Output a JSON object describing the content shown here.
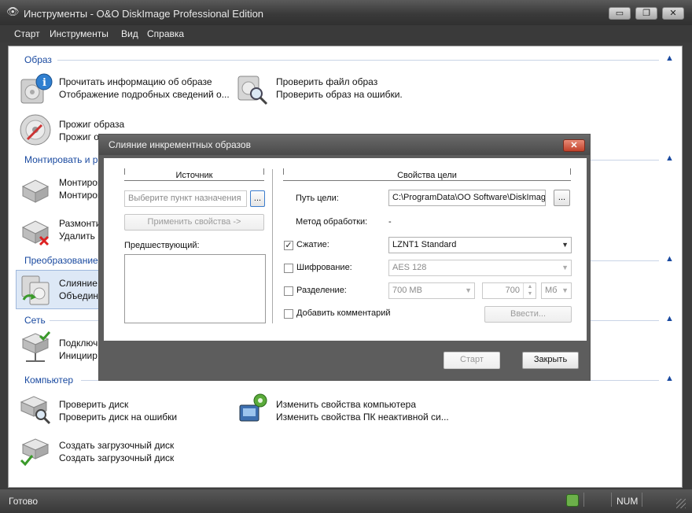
{
  "window": {
    "title": "Инструменты - O&O DiskImage Professional Edition",
    "controls": {
      "minimize": "▭",
      "restore": "❐",
      "close": "✕"
    }
  },
  "menu": [
    "Старт",
    "Инструменты",
    "Вид",
    "Справка"
  ],
  "sections": {
    "image": {
      "title": "Образ",
      "tasks": [
        {
          "title": "Прочитать информацию об образе",
          "desc": "Отображение подробных сведений о..."
        },
        {
          "title": "Проверить файл образ",
          "desc": "Проверить образ на ошибки."
        },
        {
          "title": "Прожиг образа",
          "desc": "Прожиг о"
        }
      ]
    },
    "mount": {
      "title": "Монтировать и ра",
      "tasks": [
        {
          "title": "Монтиров",
          "desc": "Монтиров"
        },
        {
          "title": "Размонтир",
          "desc": "Удалить п"
        }
      ]
    },
    "convert": {
      "title": "Преобразование",
      "tasks": [
        {
          "title": "Слияние и",
          "desc": "Объедини"
        }
      ]
    },
    "network": {
      "title": "Сеть",
      "tasks": [
        {
          "title": "Подключ",
          "desc": "Инициир"
        }
      ]
    },
    "computer": {
      "title": "Компьютер",
      "tasks": [
        {
          "title": "Проверить диск",
          "desc": "Проверить диск на ошибки"
        },
        {
          "title": "Изменить свойства компьютера",
          "desc": "Изменить свойства ПК неактивной си..."
        },
        {
          "title": "Создать загрузочный диск",
          "desc": "Создать загрузочный диск"
        }
      ]
    }
  },
  "dialog": {
    "title": "Слияние инкрементных образов",
    "close_glyph": "✕",
    "source": {
      "group_title": "Источник",
      "destination_placeholder": "Выберите пункт назначения",
      "browse_label": "...",
      "apply_label": "Применить свойства ->",
      "previous_label": "Предшествующий:"
    },
    "target": {
      "group_title": "Свойства цели",
      "path_label": "Путь цели:",
      "path_value": "C:\\ProgramData\\OO Software\\DiskImag",
      "browse_label": "...",
      "method_label": "Метод обработки:",
      "method_value": "-",
      "compression_label": "Сжатие:",
      "compression_checked": true,
      "compression_value": "LZNT1 Standard",
      "encryption_label": "Шифрование:",
      "encryption_checked": false,
      "encryption_value": "AES 128",
      "split_label": "Разделение:",
      "split_checked": false,
      "split_preset": "700 MB",
      "split_size": "700",
      "split_unit": "Мб",
      "comment_label": "Добавить комментарий",
      "comment_checked": false,
      "enter_label": "Ввести..."
    },
    "buttons": {
      "start": "Старт",
      "close": "Закрыть"
    }
  },
  "status": {
    "text": "Готово",
    "num": "NUM"
  },
  "colors": {
    "section_title": "#1a4aa0",
    "dialog_frame": "#5d5d5d",
    "close_red": "#c2412a"
  }
}
